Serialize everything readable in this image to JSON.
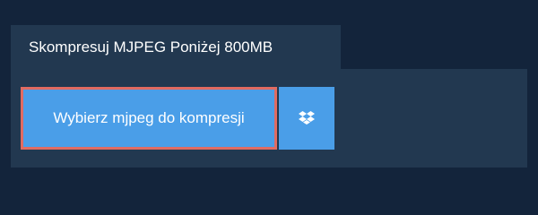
{
  "tab": {
    "title": "Skompresuj MJPEG Poniżej 800MB"
  },
  "upload": {
    "choose_label": "Wybierz mjpeg do kompresji",
    "dropbox_icon": "dropbox-icon"
  },
  "colors": {
    "page_background": "#13243b",
    "panel_background": "#223850",
    "button_blue": "#4a9ee8",
    "highlight_border": "#e06b62",
    "text": "#ffffff"
  }
}
